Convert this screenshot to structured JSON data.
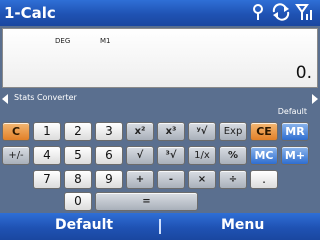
{
  "title_bar": {
    "app_title": "1-Calc",
    "icons": [
      "connection-icon",
      "sync-icon",
      "signal-strength-icon"
    ]
  },
  "display": {
    "angle_mode": "DEG",
    "memory_indicator": "M1",
    "value": "0."
  },
  "mode_row": {
    "left_label": "Stats Converter",
    "right_label": "Default"
  },
  "keypad": {
    "row1": [
      "C",
      "1",
      "2",
      "3",
      "x²",
      "x³",
      "ʸ√",
      "Exp",
      "CE",
      "MR"
    ],
    "row2": [
      "+/-",
      "4",
      "5",
      "6",
      "√",
      "³√",
      "1/x",
      "%",
      "MC",
      "M+"
    ],
    "row3": [
      "7",
      "8",
      "9",
      "+",
      "-",
      "×",
      "÷",
      "."
    ],
    "row4": [
      "0",
      "="
    ]
  },
  "soft_keys": {
    "left": "Default",
    "right": "Menu"
  },
  "colors": {
    "title_bar": "#1f52b3",
    "background": "#5a6f8f",
    "orange_key": "#e28028",
    "blue_key": "#2f6ed0"
  }
}
